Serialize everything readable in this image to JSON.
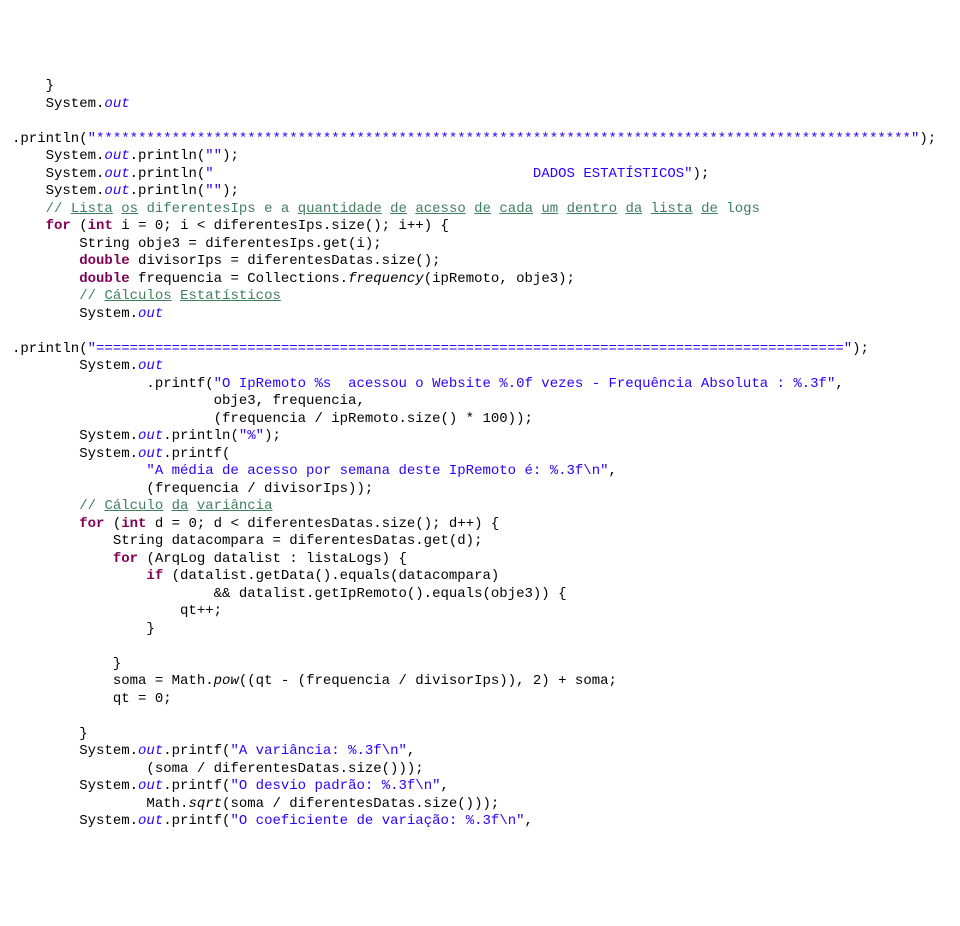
{
  "lines": [
    {
      "t": "    }",
      "parts": [
        {
          "c": "bl",
          "v": "    }"
        }
      ]
    },
    {
      "t": "    System.out",
      "parts": [
        {
          "c": "bl",
          "v": "    System."
        },
        {
          "c": "st",
          "v": "out"
        }
      ]
    },
    {
      "t": "",
      "parts": []
    },
    {
      "t": ".println(\"*************************************************************************************************\");",
      "parts": [
        {
          "c": "bl",
          "v": ".println("
        },
        {
          "c": "str",
          "v": "\"*************************************************************************************************\""
        },
        {
          "c": "bl",
          "v": ");"
        }
      ]
    },
    {
      "t": "    System.out.println(\"\");",
      "parts": [
        {
          "c": "bl",
          "v": "    System."
        },
        {
          "c": "st",
          "v": "out"
        },
        {
          "c": "bl",
          "v": ".println("
        },
        {
          "c": "str",
          "v": "\"\""
        },
        {
          "c": "bl",
          "v": ");"
        }
      ]
    },
    {
      "t": "    System.out.println(\"                                      DADOS ESTATÍSTICOS\");",
      "parts": [
        {
          "c": "bl",
          "v": "    System."
        },
        {
          "c": "st",
          "v": "out"
        },
        {
          "c": "bl",
          "v": ".println("
        },
        {
          "c": "str",
          "v": "\"                                      DADOS ESTATÍSTICOS\""
        },
        {
          "c": "bl",
          "v": ");"
        }
      ]
    },
    {
      "t": "    System.out.println(\"\");",
      "parts": [
        {
          "c": "bl",
          "v": "    System."
        },
        {
          "c": "st",
          "v": "out"
        },
        {
          "c": "bl",
          "v": ".println("
        },
        {
          "c": "str",
          "v": "\"\""
        },
        {
          "c": "bl",
          "v": ");"
        }
      ]
    },
    {
      "t": "    // Lista os diferentesIps e a quantidade de acesso de cada um dentro da lista de logs",
      "parts": [
        {
          "c": "bl",
          "v": "    "
        },
        {
          "c": "cm",
          "v": "// "
        },
        {
          "c": "cm ul",
          "v": "Lista"
        },
        {
          "c": "cm",
          "v": " "
        },
        {
          "c": "cm ul",
          "v": "os"
        },
        {
          "c": "cm",
          "v": " diferentesIps e a "
        },
        {
          "c": "cm ul",
          "v": "quantidade"
        },
        {
          "c": "cm",
          "v": " "
        },
        {
          "c": "cm ul",
          "v": "de"
        },
        {
          "c": "cm",
          "v": " "
        },
        {
          "c": "cm ul",
          "v": "acesso"
        },
        {
          "c": "cm",
          "v": " "
        },
        {
          "c": "cm ul",
          "v": "de"
        },
        {
          "c": "cm",
          "v": " "
        },
        {
          "c": "cm ul",
          "v": "cada"
        },
        {
          "c": "cm",
          "v": " "
        },
        {
          "c": "cm ul",
          "v": "um"
        },
        {
          "c": "cm",
          "v": " "
        },
        {
          "c": "cm ul",
          "v": "dentro"
        },
        {
          "c": "cm",
          "v": " "
        },
        {
          "c": "cm ul",
          "v": "da"
        },
        {
          "c": "cm",
          "v": " "
        },
        {
          "c": "cm ul",
          "v": "lista"
        },
        {
          "c": "cm",
          "v": " "
        },
        {
          "c": "cm ul",
          "v": "de"
        },
        {
          "c": "cm",
          "v": " logs"
        }
      ]
    },
    {
      "t": "    for (int i = 0; i < diferentesIps.size(); i++) {",
      "parts": [
        {
          "c": "bl",
          "v": "    "
        },
        {
          "c": "kw",
          "v": "for"
        },
        {
          "c": "bl",
          "v": " ("
        },
        {
          "c": "kw",
          "v": "int"
        },
        {
          "c": "bl",
          "v": " i = 0; i < diferentesIps.size(); i++) {"
        }
      ]
    },
    {
      "t": "        String obje3 = diferentesIps.get(i);",
      "parts": [
        {
          "c": "bl",
          "v": "        String obje3 = diferentesIps.get(i);"
        }
      ]
    },
    {
      "t": "        double divisorIps = diferentesDatas.size();",
      "parts": [
        {
          "c": "bl",
          "v": "        "
        },
        {
          "c": "kw",
          "v": "double"
        },
        {
          "c": "bl",
          "v": " divisorIps = diferentesDatas.size();"
        }
      ]
    },
    {
      "t": "        double frequencia = Collections.frequency(ipRemoto, obje3);",
      "parts": [
        {
          "c": "bl",
          "v": "        "
        },
        {
          "c": "kw",
          "v": "double"
        },
        {
          "c": "bl",
          "v": " frequencia = Collections."
        },
        {
          "c": "fn",
          "v": "frequency"
        },
        {
          "c": "bl",
          "v": "(ipRemoto, obje3);"
        }
      ]
    },
    {
      "t": "        // Cálculos Estatísticos",
      "parts": [
        {
          "c": "bl",
          "v": "        "
        },
        {
          "c": "cm",
          "v": "// "
        },
        {
          "c": "cm ul",
          "v": "Cálculos"
        },
        {
          "c": "cm",
          "v": " "
        },
        {
          "c": "cm ul",
          "v": "Estatísticos"
        }
      ]
    },
    {
      "t": "        System.out",
      "parts": [
        {
          "c": "bl",
          "v": "        System."
        },
        {
          "c": "st",
          "v": "out"
        }
      ]
    },
    {
      "t": "",
      "parts": []
    },
    {
      "t": ".println(\"=========================================================================================\");",
      "parts": [
        {
          "c": "bl",
          "v": ".println("
        },
        {
          "c": "str",
          "v": "\"=========================================================================================\""
        },
        {
          "c": "bl",
          "v": ");"
        }
      ]
    },
    {
      "t": "        System.out",
      "parts": [
        {
          "c": "bl",
          "v": "        System."
        },
        {
          "c": "st",
          "v": "out"
        }
      ]
    },
    {
      "t": "                .printf(\"O IpRemoto %s  acessou o Website %.0f vezes - Frequência Absoluta : %.3f\",",
      "parts": [
        {
          "c": "bl",
          "v": "                .printf("
        },
        {
          "c": "str",
          "v": "\"O IpRemoto %s  acessou o Website %.0f vezes - Frequência Absoluta : %.3f\""
        },
        {
          "c": "bl",
          "v": ","
        }
      ]
    },
    {
      "t": "                        obje3, frequencia,",
      "parts": [
        {
          "c": "bl",
          "v": "                        obje3, frequencia,"
        }
      ]
    },
    {
      "t": "                        (frequencia / ipRemoto.size() * 100));",
      "parts": [
        {
          "c": "bl",
          "v": "                        (frequencia / ipRemoto.size() * 100));"
        }
      ]
    },
    {
      "t": "        System.out.println(\"%\");",
      "parts": [
        {
          "c": "bl",
          "v": "        System."
        },
        {
          "c": "st",
          "v": "out"
        },
        {
          "c": "bl",
          "v": ".println("
        },
        {
          "c": "str",
          "v": "\"%\""
        },
        {
          "c": "bl",
          "v": ");"
        }
      ]
    },
    {
      "t": "        System.out.printf(",
      "parts": [
        {
          "c": "bl",
          "v": "        System."
        },
        {
          "c": "st",
          "v": "out"
        },
        {
          "c": "bl",
          "v": ".printf("
        }
      ]
    },
    {
      "t": "                \"A média de acesso por semana deste IpRemoto é: %.3f\\n\",",
      "parts": [
        {
          "c": "bl",
          "v": "                "
        },
        {
          "c": "str",
          "v": "\"A média de acesso por semana deste IpRemoto é: %.3f\\n\""
        },
        {
          "c": "bl",
          "v": ","
        }
      ]
    },
    {
      "t": "                (frequencia / divisorIps));",
      "parts": [
        {
          "c": "bl",
          "v": "                (frequencia / divisorIps));"
        }
      ]
    },
    {
      "t": "        // Cálculo da variância",
      "parts": [
        {
          "c": "bl",
          "v": "        "
        },
        {
          "c": "cm",
          "v": "// "
        },
        {
          "c": "cm ul",
          "v": "Cálculo"
        },
        {
          "c": "cm",
          "v": " "
        },
        {
          "c": "cm ul",
          "v": "da"
        },
        {
          "c": "cm",
          "v": " "
        },
        {
          "c": "cm ul",
          "v": "variância"
        }
      ]
    },
    {
      "t": "        for (int d = 0; d < diferentesDatas.size(); d++) {",
      "parts": [
        {
          "c": "bl",
          "v": "        "
        },
        {
          "c": "kw",
          "v": "for"
        },
        {
          "c": "bl",
          "v": " ("
        },
        {
          "c": "kw",
          "v": "int"
        },
        {
          "c": "bl",
          "v": " d = 0; d < diferentesDatas.size(); d++) {"
        }
      ]
    },
    {
      "t": "            String datacompara = diferentesDatas.get(d);",
      "parts": [
        {
          "c": "bl",
          "v": "            String datacompara = diferentesDatas.get(d);"
        }
      ]
    },
    {
      "t": "            for (ArqLog datalist : listaLogs) {",
      "parts": [
        {
          "c": "bl",
          "v": "            "
        },
        {
          "c": "kw",
          "v": "for"
        },
        {
          "c": "bl",
          "v": " (ArqLog datalist : listaLogs) {"
        }
      ]
    },
    {
      "t": "                if (datalist.getData().equals(datacompara)",
      "parts": [
        {
          "c": "bl",
          "v": "                "
        },
        {
          "c": "kw",
          "v": "if"
        },
        {
          "c": "bl",
          "v": " (datalist.getData().equals(datacompara)"
        }
      ]
    },
    {
      "t": "                        && datalist.getIpRemoto().equals(obje3)) {",
      "parts": [
        {
          "c": "bl",
          "v": "                        && datalist.getIpRemoto().equals(obje3)) {"
        }
      ]
    },
    {
      "t": "                    qt++;",
      "parts": [
        {
          "c": "bl",
          "v": "                    qt++;"
        }
      ]
    },
    {
      "t": "                }",
      "parts": [
        {
          "c": "bl",
          "v": "                }"
        }
      ]
    },
    {
      "t": "",
      "parts": []
    },
    {
      "t": "            }",
      "parts": [
        {
          "c": "bl",
          "v": "            }"
        }
      ]
    },
    {
      "t": "            soma = Math.pow((qt - (frequencia / divisorIps)), 2) + soma;",
      "parts": [
        {
          "c": "bl",
          "v": "            soma = Math."
        },
        {
          "c": "fn",
          "v": "pow"
        },
        {
          "c": "bl",
          "v": "((qt - (frequencia / divisorIps)), 2) + soma;"
        }
      ]
    },
    {
      "t": "            qt = 0;",
      "parts": [
        {
          "c": "bl",
          "v": "            qt = 0;"
        }
      ]
    },
    {
      "t": "",
      "parts": []
    },
    {
      "t": "        }",
      "parts": [
        {
          "c": "bl",
          "v": "        }"
        }
      ]
    },
    {
      "t": "        System.out.printf(\"A variância: %.3f\\n\",",
      "parts": [
        {
          "c": "bl",
          "v": "        System."
        },
        {
          "c": "st",
          "v": "out"
        },
        {
          "c": "bl",
          "v": ".printf("
        },
        {
          "c": "str",
          "v": "\"A variância: %.3f\\n\""
        },
        {
          "c": "bl",
          "v": ","
        }
      ]
    },
    {
      "t": "                (soma / diferentesDatas.size()));",
      "parts": [
        {
          "c": "bl",
          "v": "                (soma / diferentesDatas.size()));"
        }
      ]
    },
    {
      "t": "        System.out.printf(\"O desvio padrão: %.3f\\n\",",
      "parts": [
        {
          "c": "bl",
          "v": "        System."
        },
        {
          "c": "st",
          "v": "out"
        },
        {
          "c": "bl",
          "v": ".printf("
        },
        {
          "c": "str",
          "v": "\"O desvio padrão: %.3f\\n\""
        },
        {
          "c": "bl",
          "v": ","
        }
      ]
    },
    {
      "t": "                Math.sqrt(soma / diferentesDatas.size()));",
      "parts": [
        {
          "c": "bl",
          "v": "                Math."
        },
        {
          "c": "fn",
          "v": "sqrt"
        },
        {
          "c": "bl",
          "v": "(soma / diferentesDatas.size()));"
        }
      ]
    },
    {
      "t": "        System.out.printf(\"O coeficiente de variação: %.3f\\n\",",
      "parts": [
        {
          "c": "bl",
          "v": "        System."
        },
        {
          "c": "st",
          "v": "out"
        },
        {
          "c": "bl",
          "v": ".printf("
        },
        {
          "c": "str",
          "v": "\"O coeficiente de variação: %.3f\\n\""
        },
        {
          "c": "bl",
          "v": ","
        }
      ]
    }
  ]
}
